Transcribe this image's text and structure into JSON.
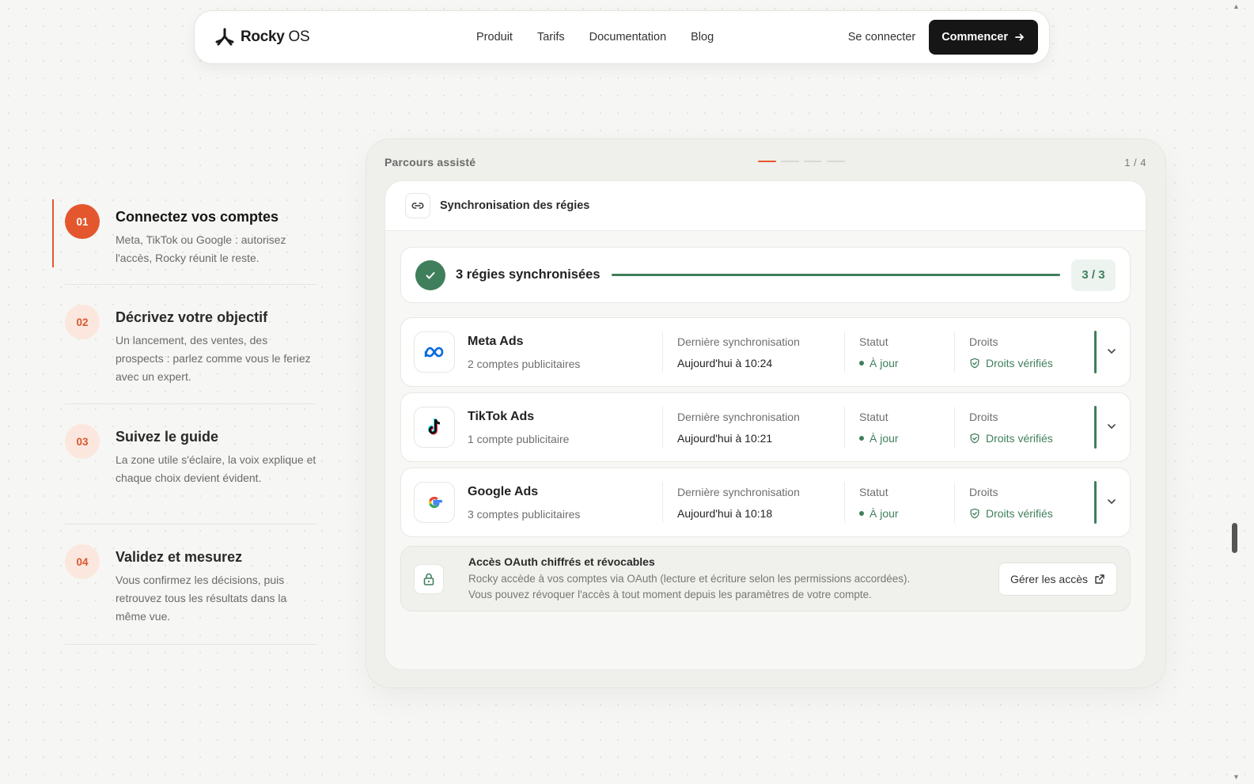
{
  "nav": {
    "brand": "Rocky",
    "brand_suffix": "OS",
    "links": [
      "Produit",
      "Tarifs",
      "Documentation",
      "Blog"
    ],
    "login": "Se connecter",
    "cta": "Commencer"
  },
  "steps": [
    {
      "num": "01",
      "title": "Connectez vos comptes",
      "desc": "Meta, TikTok ou Google : autorisez l'accès, Rocky réunit le reste.",
      "active": true
    },
    {
      "num": "02",
      "title": "Décrivez votre objectif",
      "desc": "Un lancement, des ventes, des prospects : parlez comme vous le feriez avec un expert.",
      "active": false
    },
    {
      "num": "03",
      "title": "Suivez le guide",
      "desc": "La zone utile s'éclaire, la voix explique et chaque choix devient évident.",
      "active": false
    },
    {
      "num": "04",
      "title": "Validez et mesurez",
      "desc": "Vous confirmez les décisions, puis retrouvez tous les résultats dans la même vue.",
      "active": false
    }
  ],
  "panel": {
    "title": "Parcours assisté",
    "page": "1 / 4",
    "progress_step": 1,
    "progress_total": 4
  },
  "card": {
    "title": "Synchronisation des régies",
    "summary": "3 régies synchronisées",
    "progress_fraction": 1.0,
    "count": "3 / 3"
  },
  "platforms": [
    {
      "name": "Meta Ads",
      "sub": "2 comptes publicitaires",
      "icon": "meta-icon",
      "sync_label": "Dernière synchronisation",
      "sync_value": "Aujourd'hui à 10:24",
      "status_label": "Statut",
      "status_value": "À jour",
      "rights_label": "Droits",
      "rights_value": "Droits vérifiés"
    },
    {
      "name": "TikTok Ads",
      "sub": "1 compte publicitaire",
      "icon": "tiktok-icon",
      "sync_label": "Dernière synchronisation",
      "sync_value": "Aujourd'hui à 10:21",
      "status_label": "Statut",
      "status_value": "À jour",
      "rights_label": "Droits",
      "rights_value": "Droits vérifiés"
    },
    {
      "name": "Google Ads",
      "sub": "3 comptes publicitaires",
      "icon": "google-icon",
      "sync_label": "Dernière synchronisation",
      "sync_value": "Aujourd'hui à 10:18",
      "status_label": "Statut",
      "status_value": "À jour",
      "rights_label": "Droits",
      "rights_value": "Droits vérifiés"
    }
  ],
  "oauth": {
    "title": "Accès OAuth chiffrés et révocables",
    "line1": "Rocky accède à vos comptes via OAuth (lecture et écriture selon les permissions accordées).",
    "line2": "Vous pouvez révoquer l'accès à tout moment depuis les paramètres de votre compte.",
    "button": "Gérer les accès"
  },
  "colors": {
    "accent": "#e4572e",
    "success": "#3f7f5c",
    "dark": "#161616"
  }
}
